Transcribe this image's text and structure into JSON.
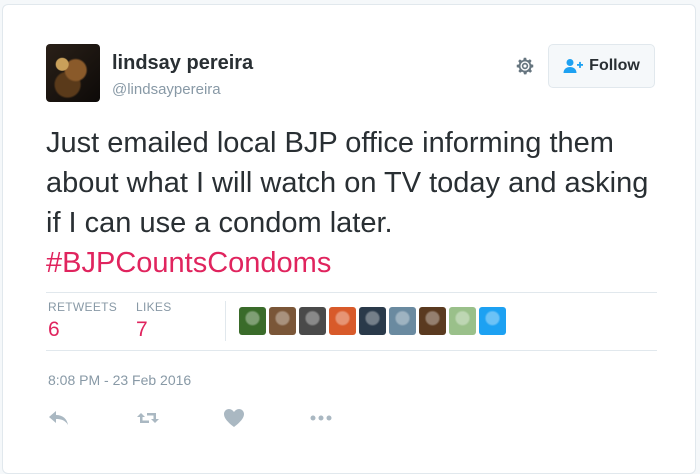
{
  "user": {
    "name": "lindsay pereira",
    "handle": "@lindsaypereira",
    "avatar_icon": "profile-photo"
  },
  "follow_button": {
    "label": "Follow",
    "icon": "add-user-icon"
  },
  "settings_icon": "gear-icon",
  "tweet": {
    "text": "Just emailed local BJP office informing them about what I will watch on TV today and asking if I can use a condom later.",
    "hashtag": "#BJPCountsCondoms"
  },
  "stats": {
    "retweets_label": "RETWEETS",
    "retweets_value": "6",
    "likes_label": "LIKES",
    "likes_value": "7"
  },
  "likers": [
    {
      "icon": "avatar-1",
      "color": "#3a6b2a"
    },
    {
      "icon": "avatar-2",
      "color": "#7a5638"
    },
    {
      "icon": "avatar-3",
      "color": "#4a4a4a"
    },
    {
      "icon": "avatar-4",
      "color": "#d85a2a"
    },
    {
      "icon": "avatar-5",
      "color": "#2a3a4a"
    },
    {
      "icon": "avatar-6",
      "color": "#6a8aa0"
    },
    {
      "icon": "avatar-7",
      "color": "#5a3a20"
    },
    {
      "icon": "avatar-8",
      "color": "#9ac08a"
    },
    {
      "icon": "avatar-9",
      "color": "#1da1f2"
    }
  ],
  "timestamp": "8:08 PM - 23 Feb 2016",
  "actions": [
    "reply-icon",
    "retweet-icon",
    "like-icon",
    "more-icon"
  ],
  "colors": {
    "accent": "#e0245e",
    "muted": "#8899a6",
    "text": "#292f33",
    "border": "#e1e8ed"
  }
}
